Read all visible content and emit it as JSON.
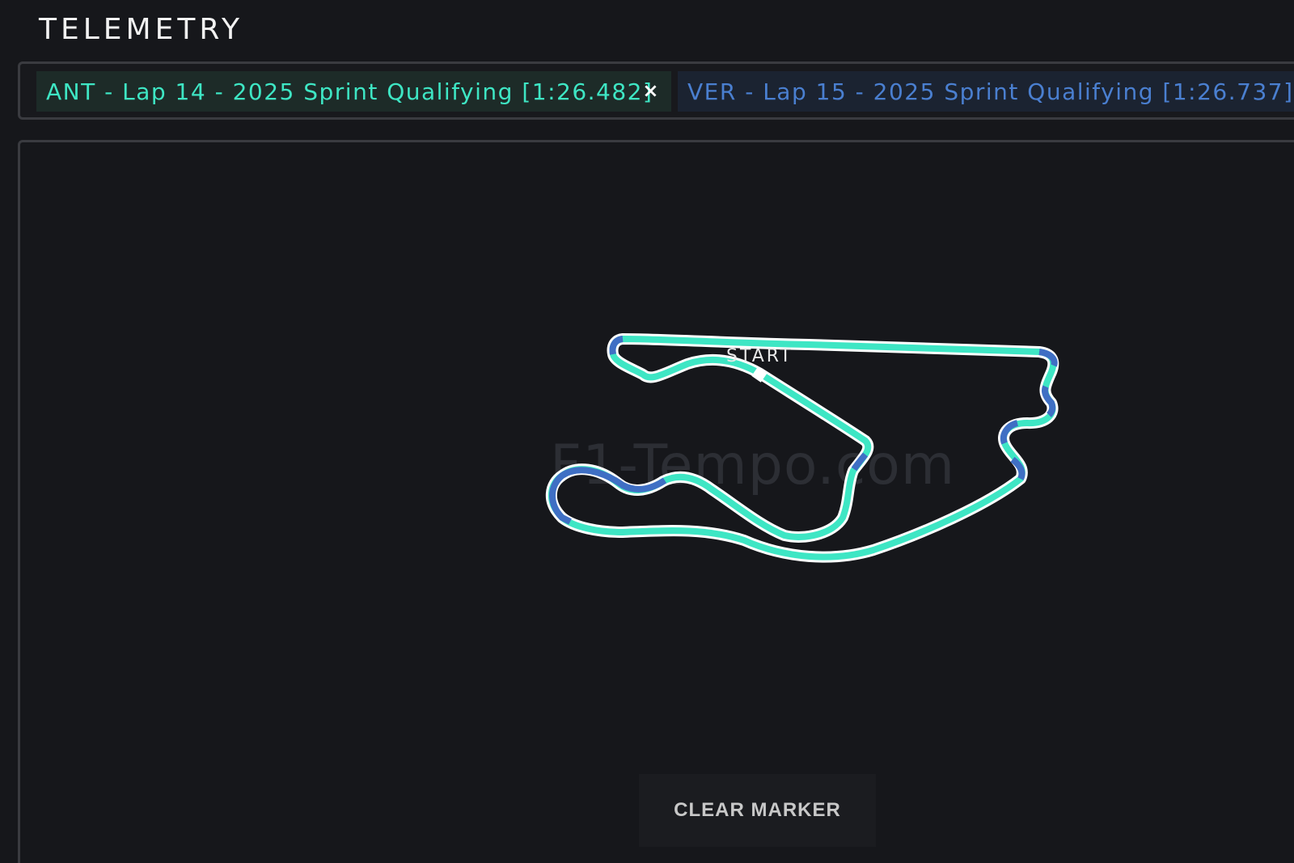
{
  "header": {
    "title": "TELEMETRY"
  },
  "laps": [
    {
      "label": "ANT - Lap 14 - 2025 Sprint Qualifying [1:26.482]",
      "close": "×",
      "color": "#3ee6c4"
    },
    {
      "label": "VER - Lap 15 - 2025 Sprint Qualifying [1:26.737]",
      "color": "#4a7fd0"
    }
  ],
  "map": {
    "watermark": "F1-Tempo.com",
    "start_label": "START",
    "colors": {
      "faster_ant": "#3ee6c4",
      "faster_ver": "#3f6fc4",
      "outline": "#ffffff"
    }
  },
  "controls": {
    "clear_marker": "CLEAR MARKER"
  }
}
